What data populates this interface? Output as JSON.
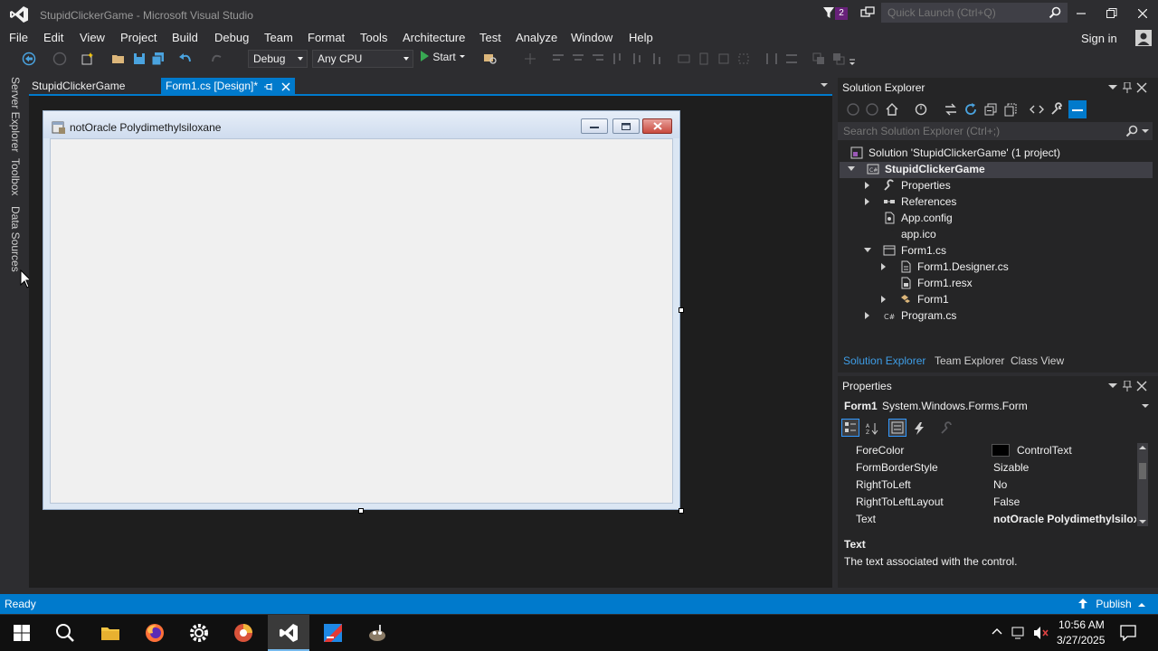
{
  "window": {
    "title": "StupidClickerGame - Microsoft Visual Studio",
    "notification_count": "2",
    "quick_launch_placeholder": "Quick Launch (Ctrl+Q)"
  },
  "menu": [
    "File",
    "Edit",
    "View",
    "Project",
    "Build",
    "Debug",
    "Team",
    "Format",
    "Tools",
    "Architecture",
    "Test",
    "Analyze",
    "Window",
    "Help"
  ],
  "account": {
    "sign_in": "Sign in"
  },
  "toolbar": {
    "config": "Debug",
    "platform": "Any CPU",
    "start": "Start"
  },
  "side_tabs": [
    "Server Explorer",
    "Toolbox",
    "Data Sources"
  ],
  "doc_tabs": {
    "inactive": "StupidClickerGame",
    "active": "Form1.cs [Design]*"
  },
  "form": {
    "title": "notOracle Polydimethylsiloxane"
  },
  "solution_explorer": {
    "title": "Solution Explorer",
    "search_placeholder": "Search Solution Explorer (Ctrl+;)",
    "tree": [
      {
        "label": "Solution 'StupidClickerGame' (1 project)",
        "icon": "solution-icon"
      },
      {
        "label": "StupidClickerGame",
        "icon": "csharp-project-icon"
      },
      {
        "label": "Properties",
        "icon": "wrench-icon"
      },
      {
        "label": "References",
        "icon": "references-icon"
      },
      {
        "label": "App.config",
        "icon": "config-file-icon"
      },
      {
        "label": "app.ico",
        "icon": "file-icon"
      },
      {
        "label": "Form1.cs",
        "icon": "form-file-icon"
      },
      {
        "label": "Form1.Designer.cs",
        "icon": "code-file-icon"
      },
      {
        "label": "Form1.resx",
        "icon": "resx-file-icon"
      },
      {
        "label": "Form1",
        "icon": "class-icon"
      },
      {
        "label": "Program.cs",
        "icon": "csharp-file-icon"
      }
    ],
    "bottom_tabs": [
      "Solution Explorer",
      "Team Explorer",
      "Class View"
    ]
  },
  "properties": {
    "title": "Properties",
    "object_name": "Form1",
    "object_type": "System.Windows.Forms.Form",
    "rows": [
      {
        "name": "ForeColor",
        "value": "ControlText",
        "swatch": "#000000"
      },
      {
        "name": "FormBorderStyle",
        "value": "Sizable"
      },
      {
        "name": "RightToLeft",
        "value": "No"
      },
      {
        "name": "RightToLeftLayout",
        "value": "False"
      },
      {
        "name": "Text",
        "value": "notOracle Polydimethylsiloxa"
      }
    ],
    "desc_title": "Text",
    "desc_text": "The text associated with the control."
  },
  "status": {
    "text": "Ready",
    "publish": "Publish"
  },
  "taskbar": {
    "time": "10:56 AM",
    "date": "3/27/2025"
  },
  "colors": {
    "accent": "#007acc",
    "background": "#2d2d30",
    "designer_bg": "#1e1e1e",
    "vs_purple": "#68217a"
  }
}
